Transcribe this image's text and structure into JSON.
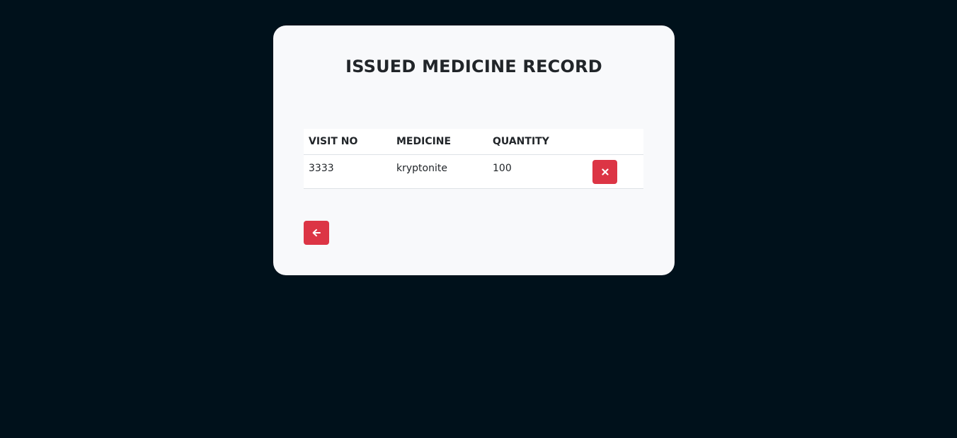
{
  "card": {
    "title": "ISSUED MEDICINE RECORD"
  },
  "table": {
    "headers": {
      "visit_no": "VISIT NO",
      "medicine": "MEDICINE",
      "quantity": "QUANTITY"
    },
    "rows": [
      {
        "visit_no": "3333",
        "medicine": "kryptonite",
        "quantity": "100",
        "action_icon": "close-icon"
      }
    ]
  },
  "back_button": {
    "icon": "arrow-left-icon"
  },
  "colors": {
    "background": "#00111b",
    "card": "#f8f9fb",
    "danger": "#dc3545",
    "text": "#212529"
  }
}
